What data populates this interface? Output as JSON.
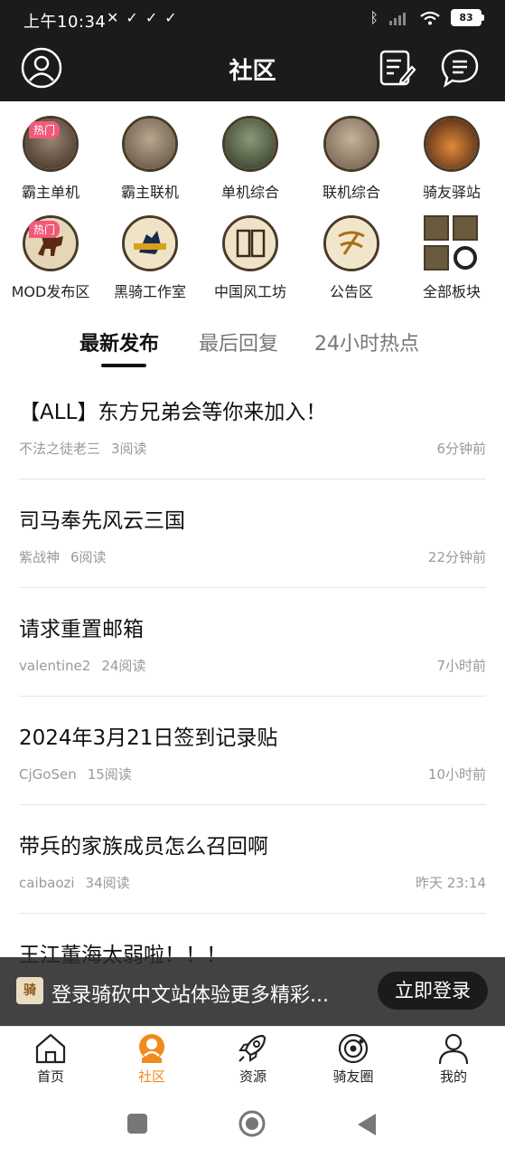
{
  "status_bar": {
    "time": "上午10:34",
    "battery": "83"
  },
  "header": {
    "title": "社区"
  },
  "categories": [
    {
      "label": "霸主单机",
      "badge": "热门",
      "color": "#6b5a48"
    },
    {
      "label": "霸主联机",
      "badge": "",
      "color": "#8a7a66"
    },
    {
      "label": "单机综合",
      "badge": "",
      "color": "#5a6a4a"
    },
    {
      "label": "联机综合",
      "badge": "",
      "color": "#9a8a74"
    },
    {
      "label": "骑友驿站",
      "badge": "",
      "color": "#a04a22"
    },
    {
      "label": "MOD发布区",
      "badge": "热门",
      "color": "#d9c6a6"
    },
    {
      "label": "黑骑工作室",
      "badge": "",
      "color": "#e8d9b6"
    },
    {
      "label": "中国风工坊",
      "badge": "",
      "color": "#e9dcc0"
    },
    {
      "label": "公告区",
      "badge": "",
      "color": "#efe3c6"
    },
    {
      "label": "全部板块",
      "badge": "",
      "color": "#6a5a3e"
    }
  ],
  "tabs": [
    {
      "label": "最新发布",
      "active": true
    },
    {
      "label": "最后回复",
      "active": false
    },
    {
      "label": "24小时热点",
      "active": false
    }
  ],
  "posts": [
    {
      "title": "【ALL】东方兄弟会等你来加入！",
      "author": "不法之徒老三",
      "reads": "3阅读",
      "time": "6分钟前"
    },
    {
      "title": "司马奉先风云三国",
      "author": "紫战神",
      "reads": "6阅读",
      "time": "22分钟前"
    },
    {
      "title": "请求重置邮箱",
      "author": "valentine2",
      "reads": "24阅读",
      "time": "7小时前"
    },
    {
      "title": "2024年3月21日签到记录贴",
      "author": "CjGoSen",
      "reads": "15阅读",
      "time": "10小时前"
    },
    {
      "title": "带兵的家族成员怎么召回啊",
      "author": "caibaozi",
      "reads": "34阅读",
      "time": "昨天 23:14"
    },
    {
      "title": "王江董海太弱啦！！！",
      "author": "",
      "reads": "",
      "time": ""
    }
  ],
  "login_banner": {
    "text": "登录骑砍中文站体验更多精彩...",
    "button": "立即登录"
  },
  "bottom_nav": [
    {
      "label": "首页",
      "icon": "home-icon",
      "active": false
    },
    {
      "label": "社区",
      "icon": "community-icon",
      "active": true
    },
    {
      "label": "资源",
      "icon": "rocket-icon",
      "active": false
    },
    {
      "label": "骑友圈",
      "icon": "circle-icon",
      "active": false
    },
    {
      "label": "我的",
      "icon": "profile-icon",
      "active": false
    }
  ],
  "accent_color": "#f08a1e"
}
